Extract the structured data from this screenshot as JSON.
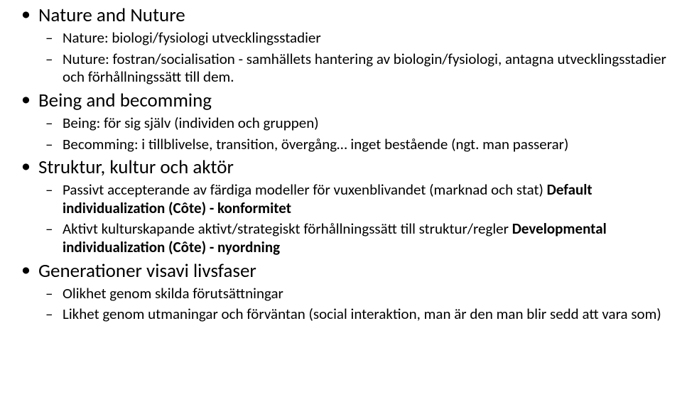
{
  "items": [
    {
      "head": "Nature and Nuture",
      "subs": [
        "Nature: biologi/fysiologi utvecklingsstadier",
        "Nuture: fostran/socialisation - samhällets hantering av biologin/fysiologi, antagna utvecklingsstadier och förhållningssätt till dem."
      ]
    },
    {
      "head": "Being and becomming",
      "subs": [
        "Being: för sig själv (individen och gruppen)",
        "Becomming: i tillblivelse, transition, övergång… inget bestående (ngt. man passerar)"
      ]
    },
    {
      "head": "Struktur, kultur och aktör",
      "subs": [
        {
          "pre": "Passivt accepterande av färdiga modeller för vuxenblivandet (marknad och stat) ",
          "bold": "Default individualization (Côte) - konformitet"
        },
        {
          "pre": "Aktivt kulturskapande aktivt/strategiskt förhållningssätt till struktur/regler ",
          "bold": "Developmental individualization (Côte) - nyordning"
        }
      ]
    },
    {
      "head": "Generationer visavi livsfaser",
      "subs": [
        "Olikhet genom skilda förutsättningar",
        "Likhet genom utmaningar och förväntan (social interaktion, man är den man blir sedd att vara som)"
      ]
    }
  ]
}
